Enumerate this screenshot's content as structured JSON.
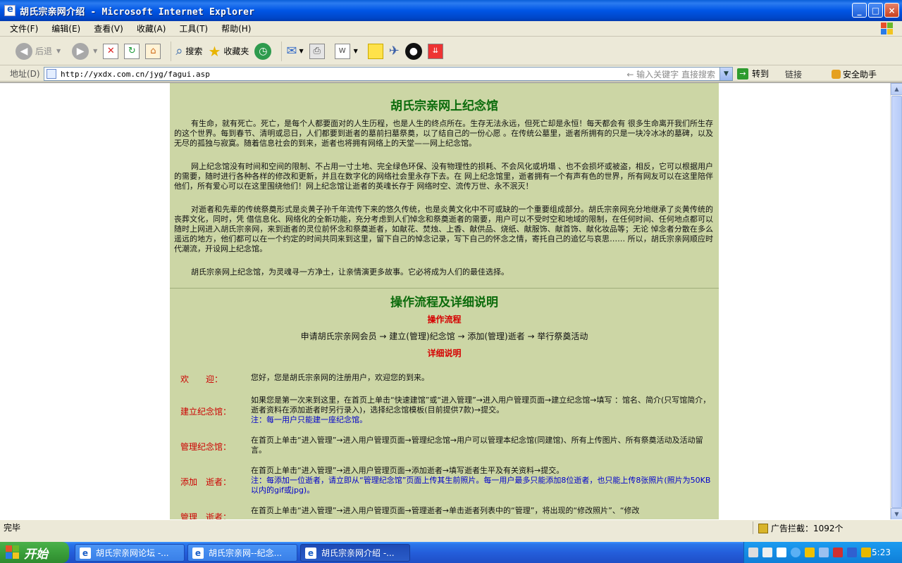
{
  "window": {
    "title": "胡氏宗亲网介绍 - Microsoft Internet Explorer",
    "buttons": [
      "_",
      "□",
      "×"
    ]
  },
  "menu": [
    "文件(F)",
    "编辑(E)",
    "查看(V)",
    "收藏(A)",
    "工具(T)",
    "帮助(H)"
  ],
  "toolbar": {
    "back": "后退",
    "search": "搜索",
    "favorites": "收藏夹"
  },
  "address": {
    "label": "地址(D)",
    "url": "http://yxdx.com.cn/jyg/fagui.asp",
    "hint": "← 输入关键字 直接搜索",
    "go": "转到",
    "links": "链接",
    "safety": "安全助手"
  },
  "page": {
    "title1": "胡氏宗亲网上纪念馆",
    "p1": "有生命，就有死亡。死亡，是每个人都要面对的人生历程，也是人生的终点所在。生存无法永远，但死亡却是永恒！每天都会有 很多生命离开我们所生存的这个世界。每到春节、清明或忌日，人们都要到逝者的墓前扫墓祭奠，以了结自己的一份心愿 。在传统公墓里，逝者所拥有的只是一块冷冰冰的墓碑，以及无尽的孤独与寂寞。随着信息社会的到来，逝者也将拥有网络上的天堂——网上纪念馆。",
    "p2": "网上纪念馆没有时间和空间的限制、不占用一寸土地、完全绿色环保、没有物理性的损耗、不会风化或坍塌 、也不会损坏或被盗，相反，它可以根据用户的需要，随时进行各种各样的修改和更新，并且在数字化的网络社会里永存下去。在 网上纪念馆里，逝者拥有一个有声有色的世界，所有网友可以在这里陪伴他们，所有爱心可以在这里围绕他们！网上纪念馆让逝者的英魂长存于 网络时空、流传万世、永不泯灭！",
    "p3": "对逝者和先辈的传统祭奠形式是炎黄子孙千年流传下来的悠久传统，也是炎黄文化中不可或缺的一个重要组成部分。胡氏宗亲网充分地继承了炎黄传统的丧葬文化，同时，凭 借信息化、网络化的全新功能，充分考虑到人们悼念和祭奠逝者的需要，用户可以不受时空和地域的限制，在任何时间、任何地点都可以随时上网进入胡氏宗亲网，来到逝者的灵位前怀念和祭奠逝者，如献花、焚烛、上香、献供品、烧纸、献服饰、献首饰、献化妆品等；无论 悼念者分散在多么遥远的地方，他们都可以在一个约定的时间共同来到这里，留下自己的悼念记录，写下自己的怀念之情，寄托自己的追忆与哀思…… 所以，胡氏宗亲网顺应时代潮流，开设网上纪念馆。",
    "p4": "胡氏宗亲网上纪念馆，为灵魂寻一方净土，让亲情演更多故事。它必将成为人们的最佳选择。",
    "title2": "操作流程及详细说明",
    "flow_title": "操作流程",
    "flow": "申请胡氏宗亲网会员 → 建立(管理)纪念馆 → 添加(管理)逝者 → 举行祭奠活动",
    "detail_title": "详细说明",
    "rows": [
      {
        "label": "欢　　迎：",
        "text": "您好，您是胡氏宗亲网的注册用户，欢迎您的到来。",
        "note": ""
      },
      {
        "label": "建立纪念馆：",
        "text": "如果您是第一次来到这里，在首页上单击“快速建馆”或“进入管理”→进入用户管理页面→建立纪念馆→填写 ：馆名、简介(只写馆简介，逝者资料在添加逝者时另行录入)，选择纪念馆模板(目前提供7款)→提交。",
        "note": "注：每一用户只能建一座纪念馆。"
      },
      {
        "label": "管理纪念馆：",
        "text": "在首页上单击“进入管理”→进入用户管理页面→管理纪念馆→用户可以管理本纪念馆(同建馆)、所有上传图片、所有祭奠活动及活动留言。",
        "note": ""
      },
      {
        "label": "添加　逝者：",
        "text": "在首页上单击“进入管理”→进入用户管理页面→添加逝者→填写逝者生平及有关资料→提交。",
        "note": "注：每添加一位逝者，请立即从“管理纪念馆”页面上传其生前照片。每一用户最多只能添加8位逝者，也只能上传8张照片(照片为50KB以内的gif或jpg)。"
      },
      {
        "label": "管理　逝者：",
        "text": "在首页上单击“进入管理”→进入用户管理页面→管理逝者→单击逝者列表中的“管理”，将出现的“修改照片”、“修改",
        "note": ""
      }
    ]
  },
  "status": {
    "text": "完毕",
    "ads": "广告拦截：1092个"
  },
  "taskbar": {
    "start": "开始",
    "tasks": [
      "胡氏宗亲网论坛 -...",
      "胡氏宗亲网--纪念...",
      "胡氏宗亲网介绍 -..."
    ],
    "clock": "5:23"
  }
}
